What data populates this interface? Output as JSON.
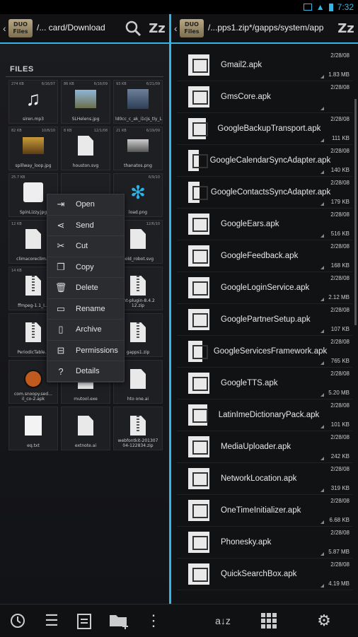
{
  "status": {
    "time": "7:32"
  },
  "left": {
    "path": "/... card/Download",
    "files_label": "FILES",
    "tiles": [
      {
        "meta_l": "274 KB",
        "meta_r": "6/16/07",
        "name": "siren.mp3",
        "kind": "music"
      },
      {
        "meta_l": "86 KB",
        "meta_r": "6/16/09",
        "name": "SLHelens.jpg",
        "kind": "photo"
      },
      {
        "meta_l": "93 KB",
        "meta_r": "6/21/09",
        "name": "ld0cc_c_ak_i1cjs_tly_LrB…",
        "kind": "photo2"
      },
      {
        "meta_l": "82 KB",
        "meta_r": "10/8/10",
        "name": "spillway_loop.jpg",
        "kind": "photo3"
      },
      {
        "meta_l": "8 KB",
        "meta_r": "12/1/08",
        "name": "houston.svg",
        "kind": "doc"
      },
      {
        "meta_l": "21 KB",
        "meta_r": "6/19/09",
        "name": "thanatos.png",
        "kind": "photo4"
      },
      {
        "meta_l": "25.7 KB",
        "meta_r": "",
        "name": "SpinLizzy.jpg",
        "kind": "face"
      },
      {
        "meta_l": "",
        "meta_r": "",
        "name": "",
        "kind": "none"
      },
      {
        "meta_l": "",
        "meta_r": "6/9/10",
        "name": "load.png",
        "kind": "flower"
      },
      {
        "meta_l": "12 KB",
        "meta_r": "",
        "name": "climacoreclim…",
        "kind": "doc"
      },
      {
        "meta_l": "",
        "meta_r": "",
        "name": "",
        "kind": "none"
      },
      {
        "meta_l": "",
        "meta_r": "12/6/10",
        "name": "bold_robot.svg",
        "kind": "doc"
      },
      {
        "meta_l": "14 KB",
        "meta_r": "",
        "name": "ffmpeg-1.1_I…",
        "kind": "zip"
      },
      {
        "meta_l": "",
        "meta_r": "",
        "name": "",
        "kind": "none"
      },
      {
        "meta_l": "",
        "meta_r": "",
        "name": "lint-plugin-8.4.2 12.zip",
        "kind": "zip"
      },
      {
        "meta_l": "",
        "meta_r": "",
        "name": "PeriodicTable…",
        "kind": "zip"
      },
      {
        "meta_l": "",
        "meta_r": "",
        "name": "",
        "kind": "none"
      },
      {
        "meta_l": "",
        "meta_r": "",
        "name": "gapps1.zip",
        "kind": "zip"
      },
      {
        "meta_l": "",
        "meta_r": "",
        "name": "com.snoopy.sed…il_co-2.apk",
        "kind": "badge"
      },
      {
        "meta_l": "",
        "meta_r": "",
        "name": "mutool.exe",
        "kind": "doc"
      },
      {
        "meta_l": "",
        "meta_r": "",
        "name": "hto one.ai",
        "kind": "doc"
      },
      {
        "meta_l": "",
        "meta_r": "",
        "name": "eq.txt",
        "kind": "note"
      },
      {
        "meta_l": "",
        "meta_r": "",
        "name": "extnote.ai",
        "kind": "doc"
      },
      {
        "meta_l": "",
        "meta_r": "",
        "name": "webfontkit-201307 04-122834.zip",
        "kind": "zip"
      }
    ],
    "menu": [
      {
        "label": "Open",
        "icon": "open-icon"
      },
      {
        "label": "Send",
        "icon": "share-icon"
      },
      {
        "label": "Cut",
        "icon": "cut-icon"
      },
      {
        "label": "Copy",
        "icon": "copy-icon"
      },
      {
        "label": "Delete",
        "icon": "trash-icon"
      },
      {
        "label": "Rename",
        "icon": "rename-icon"
      },
      {
        "label": "Archive",
        "icon": "archive-icon"
      },
      {
        "label": "Permissions",
        "icon": "lock-icon"
      },
      {
        "label": "Details",
        "icon": "help-icon"
      }
    ]
  },
  "right": {
    "path": "/...pps1.zip*/gapps/system/app",
    "files": [
      {
        "name": "Gmail2.apk",
        "date": "2/28/08",
        "size": "1.83 MB"
      },
      {
        "name": "GmsCore.apk",
        "date": "2/28/08",
        "size": ""
      },
      {
        "name": "GoogleBackupTransport.apk",
        "date": "2/28/08",
        "size": "111 KB"
      },
      {
        "name": "GoogleCalendarSyncAdapter.apk",
        "date": "2/28/08",
        "size": "140 KB"
      },
      {
        "name": "GoogleContactsSyncAdapter.apk",
        "date": "2/28/08",
        "size": "179 KB"
      },
      {
        "name": "GoogleEars.apk",
        "date": "2/28/08",
        "size": "516 KB"
      },
      {
        "name": "GoogleFeedback.apk",
        "date": "2/28/08",
        "size": "168 KB"
      },
      {
        "name": "GoogleLoginService.apk",
        "date": "2/28/08",
        "size": "2.12 MB"
      },
      {
        "name": "GooglePartnerSetup.apk",
        "date": "2/28/08",
        "size": "107 KB"
      },
      {
        "name": "GoogleServicesFramework.apk",
        "date": "2/28/08",
        "size": "765 KB"
      },
      {
        "name": "GoogleTTS.apk",
        "date": "2/28/08",
        "size": "5.20 MB"
      },
      {
        "name": "LatinImeDictionaryPack.apk",
        "date": "2/28/08",
        "size": "101 KB"
      },
      {
        "name": "MediaUploader.apk",
        "date": "2/28/08",
        "size": "242 KB"
      },
      {
        "name": "NetworkLocation.apk",
        "date": "2/28/08",
        "size": "319 KB"
      },
      {
        "name": "OneTimeInitializer.apk",
        "date": "2/28/08",
        "size": "6.68 KB"
      },
      {
        "name": "Phonesky.apk",
        "date": "2/28/08",
        "size": "5.87 MB"
      },
      {
        "name": "QuickSearchBox.apk",
        "date": "2/28/08",
        "size": "4.19 MB"
      }
    ]
  },
  "bottom": {
    "sort_label": "a↓z"
  },
  "colors": {
    "accent": "#33b5e5"
  }
}
